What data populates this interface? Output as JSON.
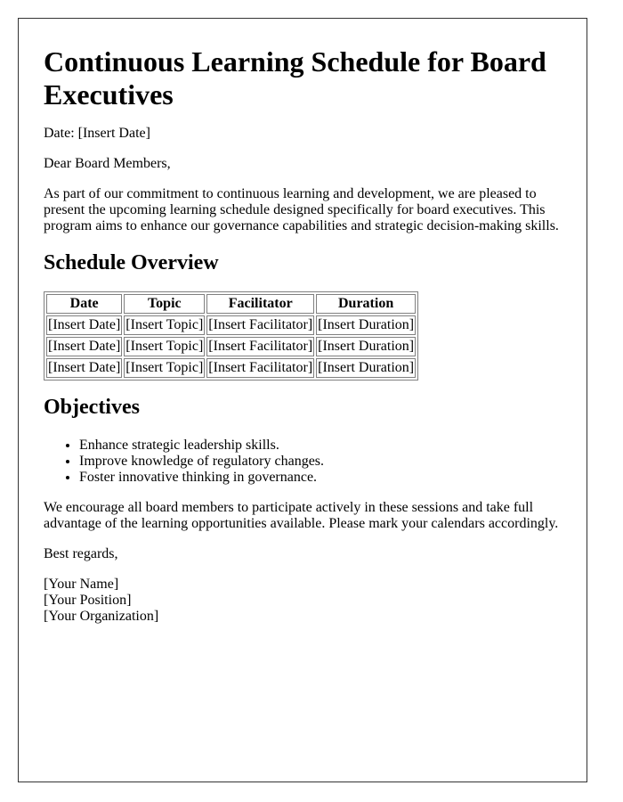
{
  "document": {
    "title": "Continuous Learning Schedule for Board Executives",
    "date_line": "Date: [Insert Date]",
    "greeting": "Dear Board Members,",
    "intro": "As part of our commitment to continuous learning and development, we are pleased to present the upcoming learning schedule designed specifically for board executives. This program aims to enhance our governance capabilities and strategic decision-making skills.",
    "schedule": {
      "heading": "Schedule Overview",
      "columns": [
        "Date",
        "Topic",
        "Facilitator",
        "Duration"
      ],
      "rows": [
        [
          "[Insert Date]",
          "[Insert Topic]",
          "[Insert Facilitator]",
          "[Insert Duration]"
        ],
        [
          "[Insert Date]",
          "[Insert Topic]",
          "[Insert Facilitator]",
          "[Insert Duration]"
        ],
        [
          "[Insert Date]",
          "[Insert Topic]",
          "[Insert Facilitator]",
          "[Insert Duration]"
        ]
      ]
    },
    "objectives": {
      "heading": "Objectives",
      "items": [
        "Enhance strategic leadership skills.",
        "Improve knowledge of regulatory changes.",
        "Foster innovative thinking in governance."
      ]
    },
    "closing": "We encourage all board members to participate actively in these sessions and take full advantage of the learning opportunities available. Please mark your calendars accordingly.",
    "regards": "Best regards,",
    "signature": {
      "name": "[Your Name]",
      "position": "[Your Position]",
      "organization": "[Your Organization]"
    }
  }
}
